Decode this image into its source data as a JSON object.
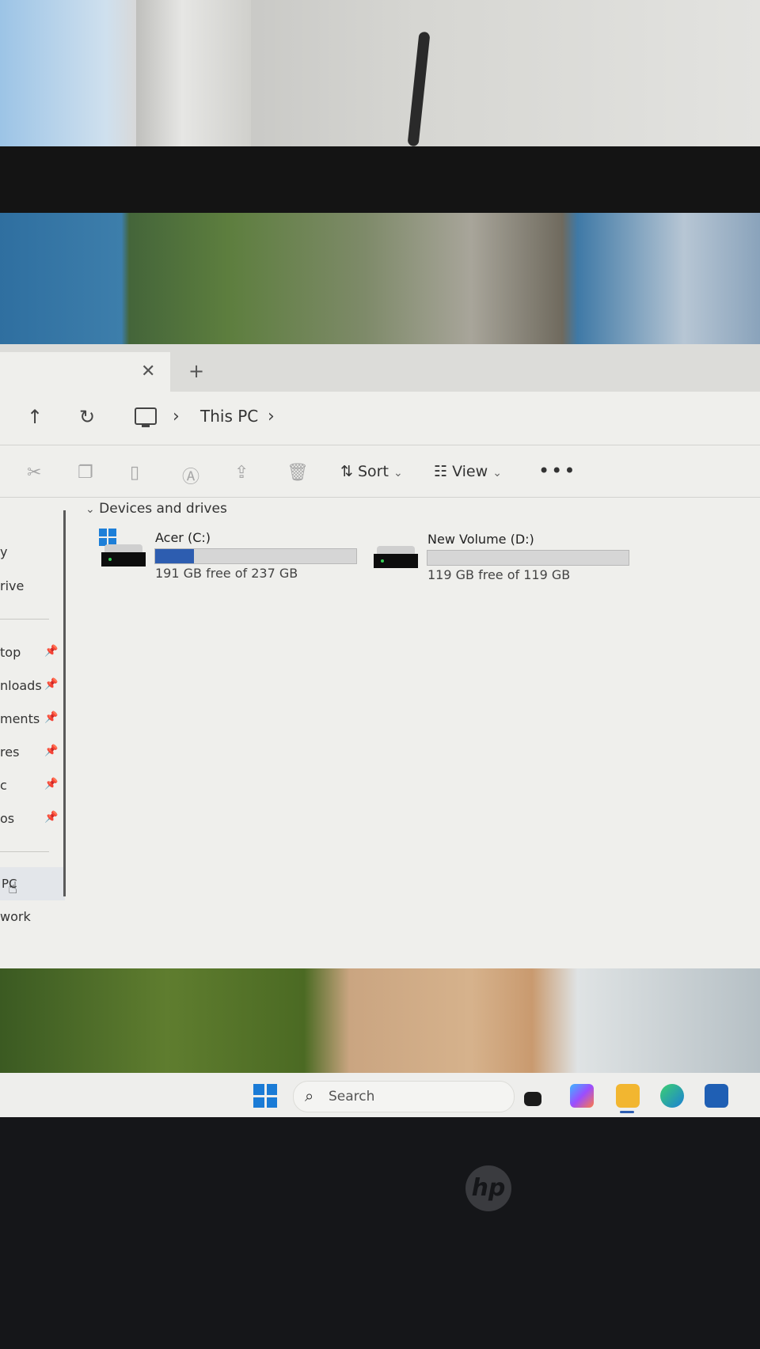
{
  "explorer": {
    "tab": {
      "close_glyph": "✕",
      "add_glyph": "+"
    },
    "address": {
      "crumb": "This PC",
      "chevron": "›"
    },
    "toolbar": {
      "sort_label": "Sort",
      "view_label": "View",
      "more_label": "•••",
      "dropdown_glyph": "⌄"
    },
    "sidebar": {
      "items": [
        {
          "label": "y"
        },
        {
          "label": "rive"
        },
        {
          "label": "top",
          "pinned": true
        },
        {
          "label": "nloads",
          "pinned": true
        },
        {
          "label": "ments",
          "pinned": true
        },
        {
          "label": "res",
          "pinned": true
        },
        {
          "label": "c",
          "pinned": true
        },
        {
          "label": "os",
          "pinned": true
        },
        {
          "label": "PC"
        },
        {
          "label": "work"
        }
      ]
    },
    "group": {
      "title": "Devices and drives",
      "chevron": "⌄"
    },
    "drives": [
      {
        "name": "Acer (C:)",
        "free": "191 GB free of 237 GB",
        "used_fraction": 0.194
      },
      {
        "name": "New Volume (D:)",
        "free": "119 GB free of 119 GB",
        "used_fraction": 0.0
      }
    ]
  },
  "taskbar": {
    "search_label": "Search"
  },
  "colors": {
    "accent": "#2d5db0",
    "windows_blue": "#1a7bd6"
  },
  "logo": "hp"
}
